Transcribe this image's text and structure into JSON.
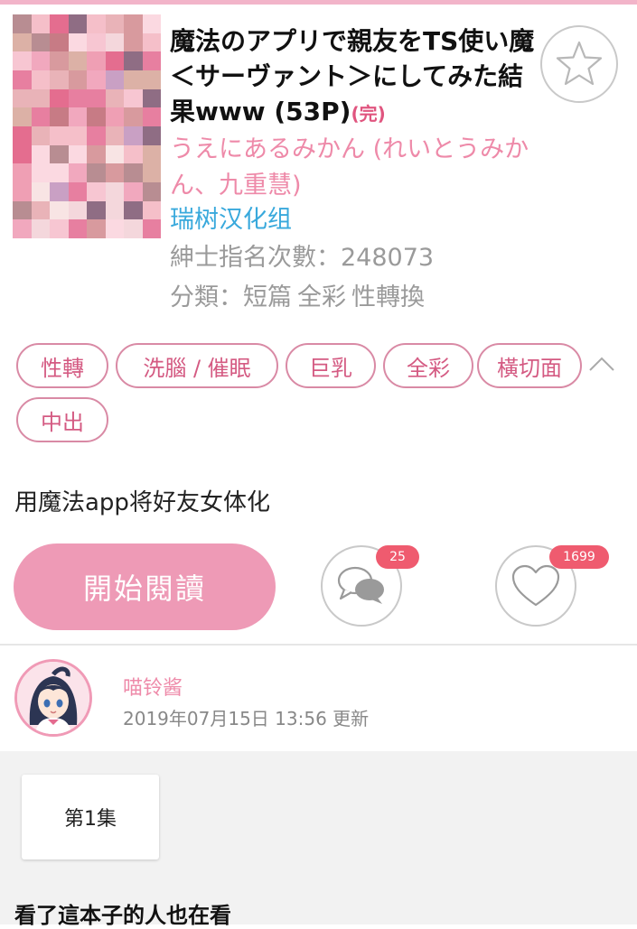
{
  "book": {
    "title": "魔法のアプリで親友をTS使い魔＜サーヴァント＞にしてみた結果www (53P)",
    "status": "(完)",
    "artist": "うえにあるみかん (れいとうみかん、九重慧)",
    "translator": "瑞树汉化组",
    "views_label": "紳士指名次數：",
    "views": "248073",
    "category_label": "分類：",
    "categories": [
      "短篇",
      "全彩",
      "性轉換"
    ],
    "description": "用魔法app将好友女体化"
  },
  "tags": [
    "性轉",
    "洗腦 / 催眠",
    "巨乳",
    "全彩",
    "橫切面",
    "中出"
  ],
  "actions": {
    "start_label": "開始閱讀",
    "comment_count": "25",
    "like_count": "1699"
  },
  "uploader": {
    "name": "喵铃酱",
    "updated": "2019年07月15日 13:56 更新"
  },
  "episodes": [
    "第1集"
  ],
  "related_heading": "看了這本子的人也在看",
  "colors": {
    "accent_pink": "#ee9ab6",
    "tag_border": "#d98aa5",
    "badge_red": "#ef5b6f",
    "translator_blue": "#39a9dc",
    "artist_pink": "#ee8aa9"
  },
  "icons": [
    "star-icon",
    "chevron-up-icon",
    "comment-icon",
    "heart-icon"
  ]
}
